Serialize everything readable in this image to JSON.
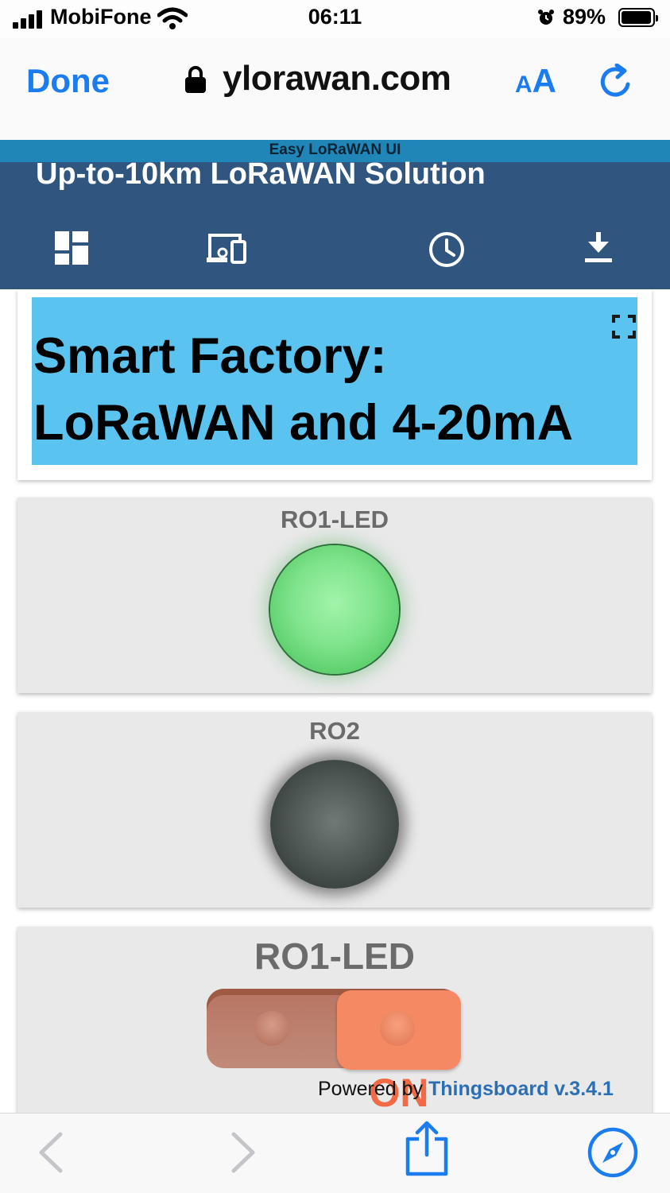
{
  "status_bar": {
    "carrier": "MobiFone",
    "time": "06:11",
    "battery_percent": "89%",
    "battery_level": 0.89,
    "icons": [
      "signal-icon",
      "wifi-icon",
      "alarm-icon",
      "battery-icon"
    ]
  },
  "browser": {
    "done_label": "Done",
    "url": "ylorawan.com",
    "text_size_small": "A",
    "text_size_big": "A",
    "icons": [
      "lock-icon",
      "reload-icon"
    ],
    "accent_color": "#1b7cf0"
  },
  "app": {
    "strip_title": "Easy LoRaWAN UI",
    "header_title": "Up-to-10km LoRaWAN Solution",
    "toolbar_icons": [
      "dashboard-icon",
      "devices-icon",
      "clock-icon",
      "download-icon"
    ],
    "header_color": "#305680"
  },
  "dashboard": {
    "title_line1": "Smart Factory:",
    "title_line2": "LoRaWAN and 4-20mA",
    "title_bg_color": "#5bc3ef",
    "widgets": [
      {
        "label": "RO1-LED",
        "type": "led",
        "state": "on",
        "color": "#7fe38c"
      },
      {
        "label": "RO2",
        "type": "led",
        "state": "off",
        "color": "#4c5552"
      },
      {
        "label": "RO1-LED",
        "type": "switch",
        "state_label": "ON",
        "checked": true,
        "color": "#f48964"
      }
    ]
  },
  "footer": {
    "powered_prefix": "Powered by ",
    "powered_link": "Thingsboard v.3.4.1"
  },
  "bottom_bar": {
    "icons": [
      "back-icon",
      "forward-icon",
      "share-icon",
      "compass-icon"
    ]
  }
}
